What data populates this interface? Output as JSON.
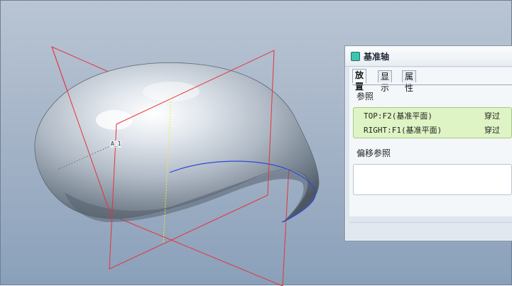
{
  "viewport": {
    "axis_tag": "A_1",
    "colors": {
      "background_top": "#b9c5d4",
      "background_bottom": "#8aa0ba",
      "datum_plane": "#e8323a",
      "datum_axis": "#f2ee22",
      "curve": "#2e49d8",
      "surface": "#c9d2dc"
    }
  },
  "dialog": {
    "title": "基准轴",
    "icon": "datum-axis-icon",
    "tabs": [
      {
        "label": "放置",
        "active": true
      },
      {
        "label": "显示",
        "active": false
      },
      {
        "label": "属性",
        "active": false
      }
    ],
    "references_label": "参照",
    "references": [
      {
        "name": "TOP:F2(基准平面)",
        "type": "穿过"
      },
      {
        "name": "RIGHT:F1(基准平面)",
        "type": "穿过"
      }
    ],
    "offset_references_label": "偏移参照"
  }
}
